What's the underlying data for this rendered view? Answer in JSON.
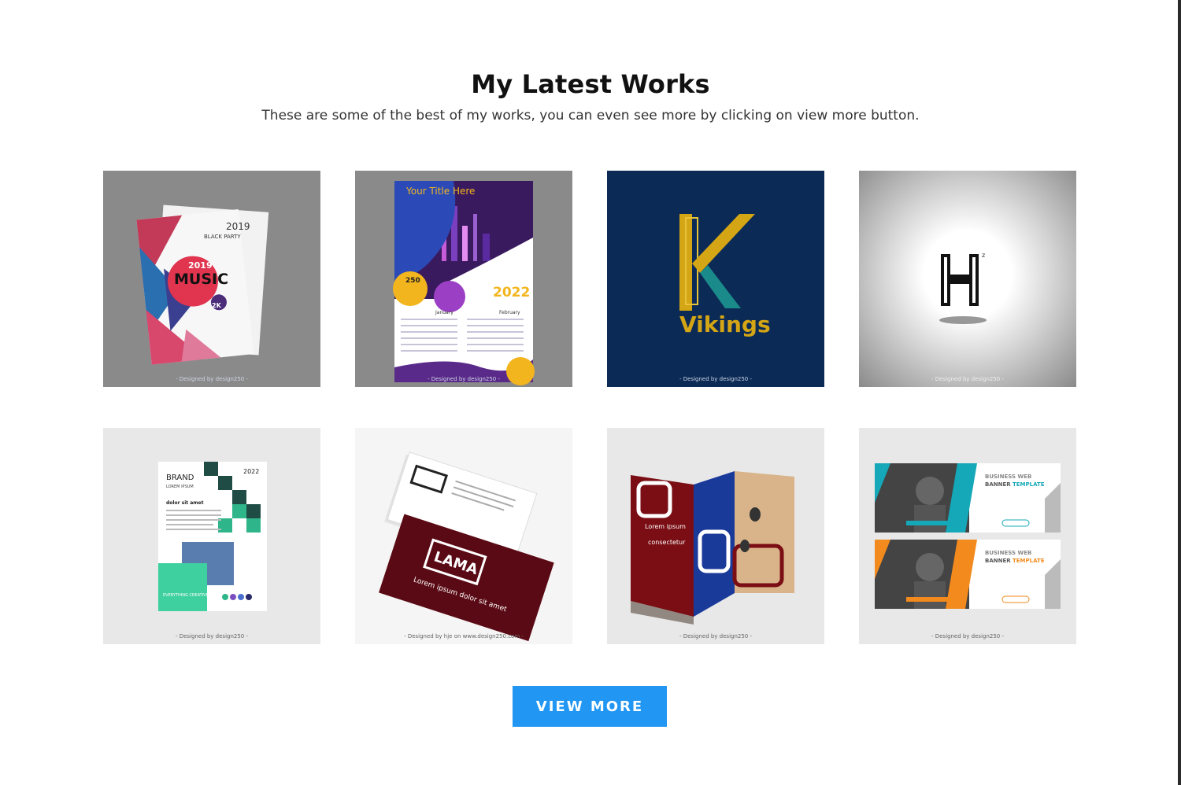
{
  "section": {
    "title": "My Latest Works",
    "subtitle": "These are some of the best of my works, you can even see more by clicking on view more button."
  },
  "works": [
    {
      "credit": "- Designed by design250 -",
      "year_top": "2019",
      "party": "BLACK PARTY",
      "music_year": "2019",
      "music": "MUSIC",
      "badge": "2K"
    },
    {
      "credit": "- Designed by design250 -",
      "heading": "Your Title Here",
      "year": "2022",
      "badge": "250",
      "month1": "January",
      "month2": "February"
    },
    {
      "credit": "- Designed by design250 -",
      "logo_letter": "K",
      "logo_name": "Vikings"
    },
    {
      "credit": "- Designed by design250 -",
      "logo_letter": "H"
    },
    {
      "credit": "- Designed by design250 -",
      "brand": "BRAND",
      "brand_sub": "LOREM IPSUM",
      "year": "2022",
      "heading": "dolor sit amet",
      "footer": "EVERYTHING CREATIVE"
    },
    {
      "credit": "- Designed by hje on www.design250.com -",
      "logo": "LAMA",
      "tagline": "Lorem ipsum dolor sit amet"
    },
    {
      "credit": "- Designed by design250 -",
      "text1": "Lorem ipsum",
      "text2": "consectetur"
    },
    {
      "credit": "- Designed by design250 -",
      "banner_title": "BUSINESS WEB",
      "banner_accent": "BANNER",
      "banner_word": "TEMPLATE",
      "button": "LEARN MORE"
    }
  ],
  "button": {
    "label": "VIEW MORE"
  },
  "colors": {
    "accent": "#2196f3",
    "tile_gray": "#8a8a8a",
    "navy": "#0b2a55",
    "gold": "#d4a514"
  }
}
